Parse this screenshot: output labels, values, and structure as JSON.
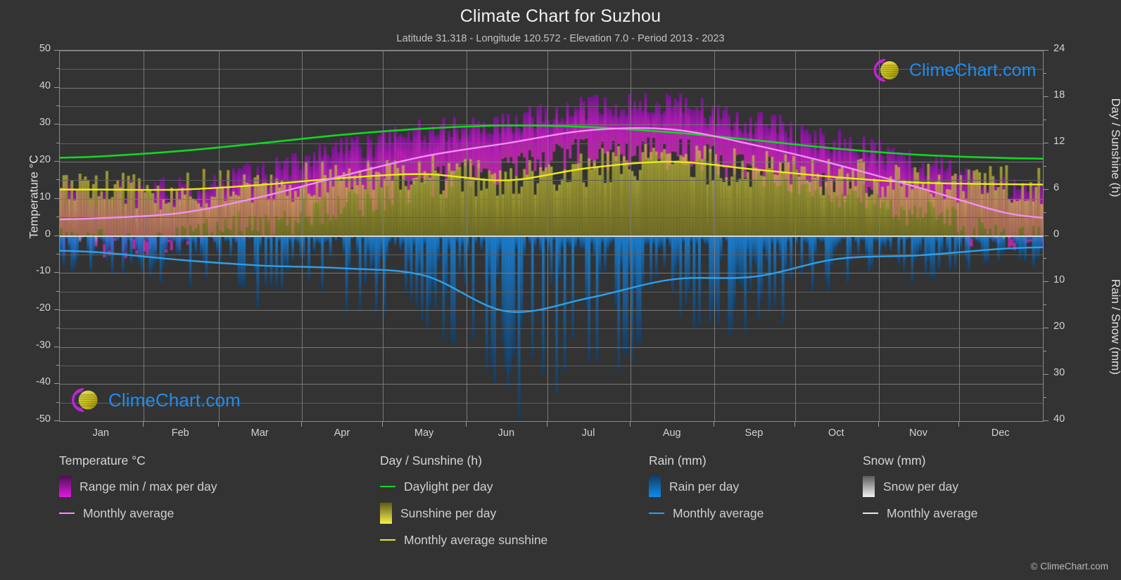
{
  "header": {
    "title": "Climate Chart for Suzhou",
    "subtitle": "Latitude 31.318 - Longitude 120.572 - Elevation 7.0 - Period 2013 - 2023"
  },
  "watermark": {
    "text": "ClimeChart.com",
    "logo_arc_color": "#e01ae0",
    "logo_sphere_color": "#d4cc22",
    "text_color": "#1f8cf0"
  },
  "copyright": "© ClimeChart.com",
  "axes": {
    "left_title": "Temperature °C",
    "right_top_title": "Day / Sunshine (h)",
    "right_bottom_title": "Rain / Snow (mm)",
    "left_ticks": [
      "50",
      "40",
      "30",
      "20",
      "10",
      "0",
      "-10",
      "-20",
      "-30",
      "-40",
      "-50"
    ],
    "right_top_ticks": [
      "24",
      "18",
      "12",
      "6",
      "0"
    ],
    "right_bottom_ticks": [
      "10",
      "20",
      "30",
      "40"
    ],
    "x_ticks": [
      "Jan",
      "Feb",
      "Mar",
      "Apr",
      "May",
      "Jun",
      "Jul",
      "Aug",
      "Sep",
      "Oct",
      "Nov",
      "Dec"
    ],
    "temp_range": [
      -50,
      50
    ],
    "sunshine_range": [
      0,
      24
    ],
    "rain_range": [
      0,
      40
    ]
  },
  "legend": {
    "groups": [
      {
        "title": "Temperature °C",
        "items": [
          {
            "label": "Range min / max per day",
            "marker": "gradient-box",
            "color": "#e617e6",
            "color2": "#4a1050"
          },
          {
            "label": "Monthly average",
            "marker": "line",
            "color": "#f58ef5"
          }
        ]
      },
      {
        "title": "Day / Sunshine (h)",
        "items": [
          {
            "label": "Daylight per day",
            "marker": "line",
            "color": "#10d820"
          },
          {
            "label": "Sunshine per day",
            "marker": "gradient-box",
            "color": "#f2f24a",
            "color2": "#5e5a18"
          },
          {
            "label": "Monthly average sunshine",
            "marker": "line",
            "color": "#ebeb18"
          }
        ]
      },
      {
        "title": "Rain (mm)",
        "items": [
          {
            "label": "Rain per day",
            "marker": "gradient-box",
            "color": "#0a8ef0",
            "color2": "#123c64"
          },
          {
            "label": "Monthly average",
            "marker": "line",
            "color": "#2f9fe8"
          }
        ]
      },
      {
        "title": "Snow (mm)",
        "items": [
          {
            "label": "Snow per day",
            "marker": "gradient-box",
            "color": "#f2f2f2",
            "color2": "#5a5a5a"
          },
          {
            "label": "Monthly average",
            "marker": "line",
            "color": "#e8e8e8"
          }
        ]
      }
    ]
  },
  "chart_data": {
    "type": "line",
    "title": "Climate Chart for Suzhou",
    "subtitle": "Latitude 31.318 - Longitude 120.572 - Elevation 7.0 - Period 2013 - 2023",
    "xlabel": "",
    "ylabel": "Temperature °C",
    "ylim": [
      -50,
      50
    ],
    "grid": true,
    "legend_position": "below",
    "categories": [
      "Jan",
      "Feb",
      "Mar",
      "Apr",
      "May",
      "Jun",
      "Jul",
      "Aug",
      "Sep",
      "Oct",
      "Nov",
      "Dec"
    ],
    "series": [
      {
        "name": "Monthly average",
        "unit": "°C",
        "axis": "temperature",
        "color": "#f58ef5",
        "values": [
          4.8,
          6.2,
          10.5,
          16.2,
          21.5,
          25.0,
          28.5,
          28.7,
          24.5,
          19.2,
          13.0,
          6.5
        ]
      },
      {
        "name": "Daylight per day",
        "unit": "h",
        "axis": "sunshine",
        "color": "#10d820",
        "values": [
          10.3,
          11.0,
          12.0,
          13.1,
          13.9,
          14.3,
          14.1,
          13.4,
          12.4,
          11.3,
          10.5,
          10.1
        ]
      },
      {
        "name": "Monthly average sunshine",
        "unit": "h",
        "axis": "sunshine",
        "color": "#ebeb18",
        "values": [
          6.0,
          6.0,
          6.6,
          7.5,
          8.0,
          7.2,
          8.8,
          9.6,
          8.6,
          7.6,
          6.9,
          6.7
        ]
      },
      {
        "name": "Rain monthly average",
        "unit": "mm",
        "axis": "rain",
        "color": "#2f9fe8",
        "values": [
          3.6,
          5.2,
          6.4,
          7.0,
          8.6,
          16.3,
          13.4,
          9.4,
          8.8,
          5.0,
          4.2,
          2.8
        ]
      },
      {
        "name": "Range min / max per day",
        "unit": "°C",
        "axis": "temperature",
        "color": "#e617e6",
        "min_values": [
          0.5,
          1.8,
          5.4,
          11.0,
          16.5,
          21.0,
          24.8,
          24.9,
          20.5,
          14.5,
          8.2,
          2.0
        ],
        "max_values": [
          9.0,
          10.8,
          15.6,
          21.4,
          26.2,
          29.0,
          33.0,
          33.4,
          28.8,
          23.6,
          17.6,
          11.4
        ]
      },
      {
        "name": "Sunshine per day",
        "unit": "h",
        "axis": "sunshine",
        "color": "#d4d44a",
        "values": [
          6.0,
          6.0,
          6.6,
          7.5,
          8.0,
          7.2,
          8.8,
          9.6,
          8.6,
          7.6,
          6.9,
          6.7
        ]
      },
      {
        "name": "Rain per day",
        "unit": "mm",
        "axis": "rain",
        "color": "#0a8ef0",
        "values": [
          3.6,
          5.2,
          6.4,
          7.0,
          8.6,
          16.3,
          13.4,
          9.4,
          8.8,
          5.0,
          4.2,
          2.8
        ]
      },
      {
        "name": "Snow per day",
        "unit": "mm",
        "axis": "snow",
        "color": "#f2f2f2",
        "values": [
          0.2,
          0.1,
          0.0,
          0.0,
          0.0,
          0.0,
          0.0,
          0.0,
          0.0,
          0.0,
          0.0,
          0.1
        ]
      }
    ]
  }
}
